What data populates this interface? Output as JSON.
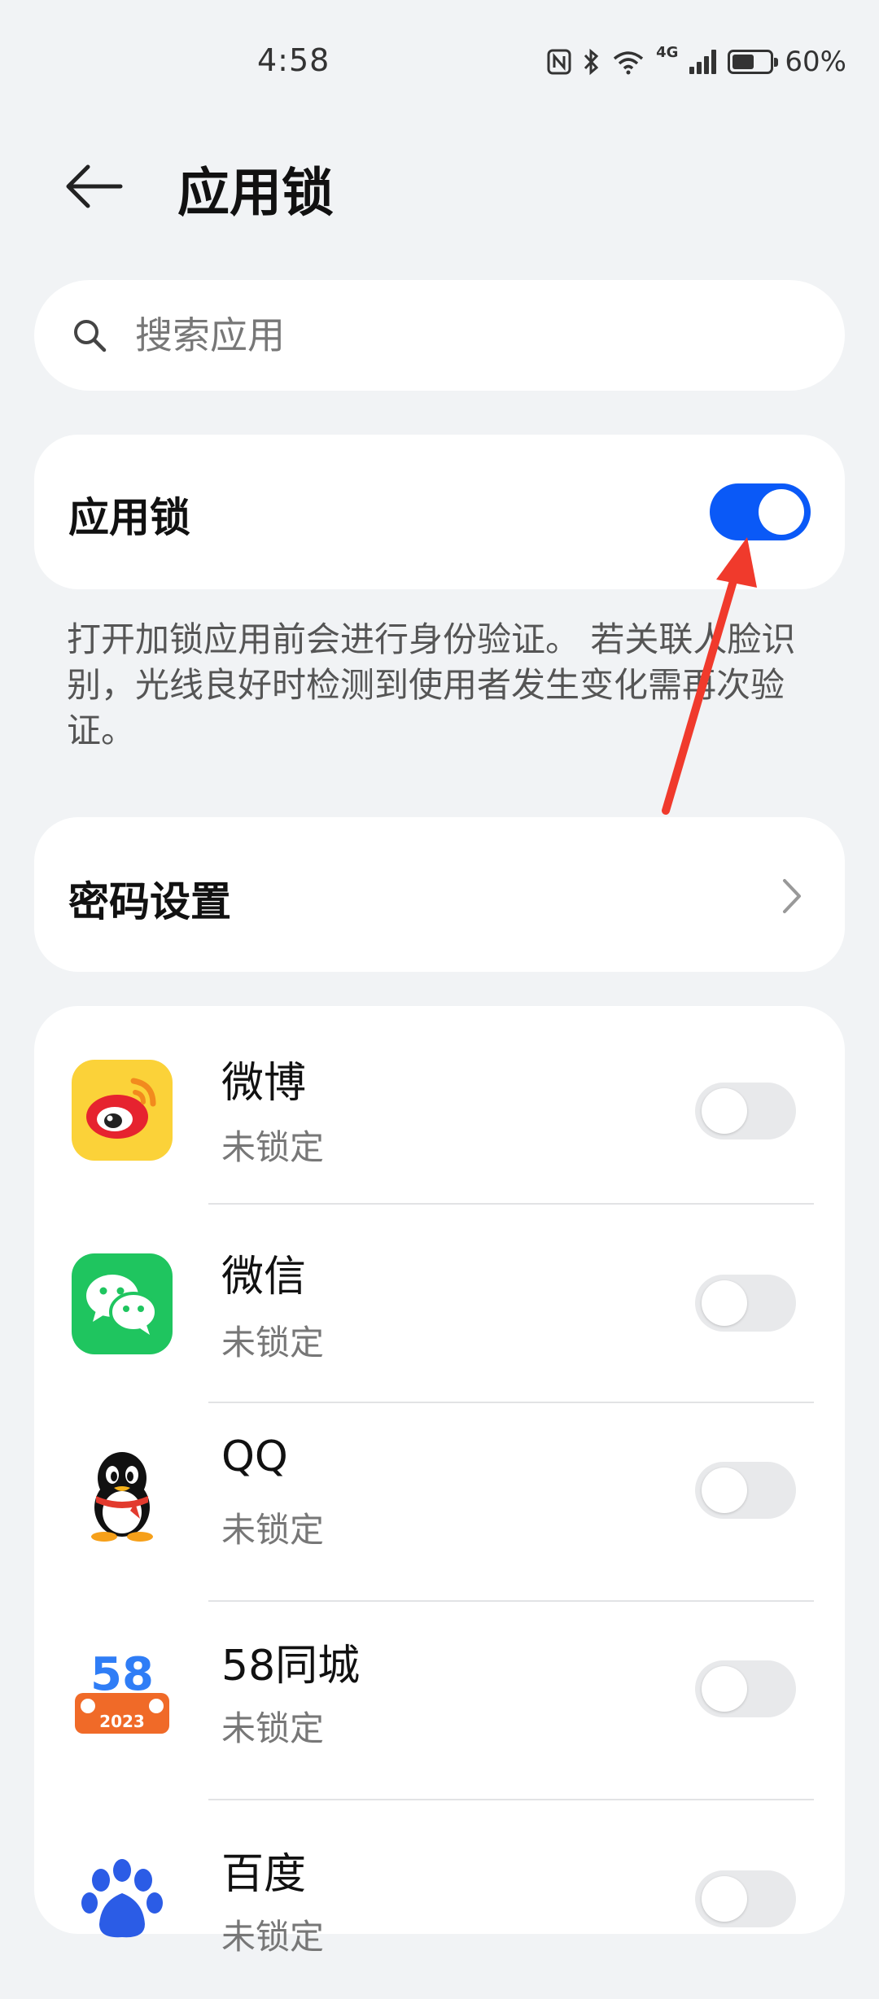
{
  "status_bar": {
    "time": "4:58",
    "network": "4G",
    "battery_percent": "60%",
    "battery_level": 0.6
  },
  "header": {
    "title": "应用锁"
  },
  "search": {
    "placeholder": "搜索应用"
  },
  "app_lock": {
    "label": "应用锁",
    "enabled": true,
    "description": "打开加锁应用前会进行身份验证。 若关联人脸识别，光线良好时检测到使用者发生变化需再次验证。"
  },
  "password_settings": {
    "label": "密码设置"
  },
  "apps": [
    {
      "name": "微博",
      "status": "未锁定",
      "locked": false,
      "icon": "weibo-icon"
    },
    {
      "name": "微信",
      "status": "未锁定",
      "locked": false,
      "icon": "wechat-icon"
    },
    {
      "name": "QQ",
      "status": "未锁定",
      "locked": false,
      "icon": "qq-icon"
    },
    {
      "name": "58同城",
      "status": "未锁定",
      "locked": false,
      "icon": "58tongcheng-icon",
      "icon_text": "58",
      "icon_subtext": "2023"
    },
    {
      "name": "百度",
      "status": "未锁定",
      "locked": false,
      "icon": "baidu-icon"
    }
  ],
  "colors": {
    "accent": "#0a59f7",
    "background": "#f1f3f5",
    "annotation_arrow": "#f03a2c"
  }
}
